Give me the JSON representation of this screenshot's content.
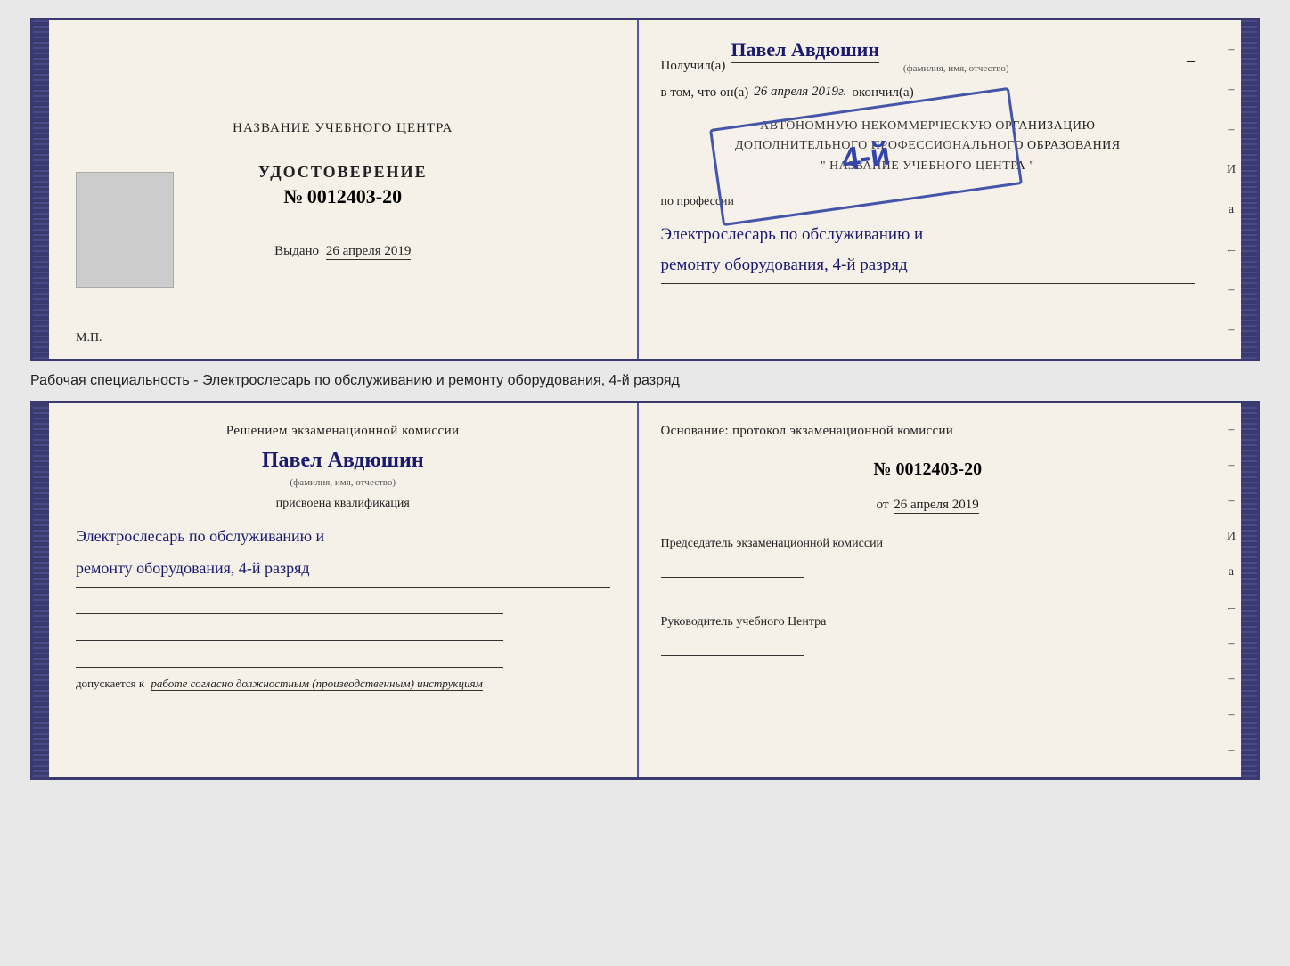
{
  "page": {
    "background_color": "#e8e8e8"
  },
  "top_booklet": {
    "left_page": {
      "title": "НАЗВАНИЕ УЧЕБНОГО ЦЕНТРА",
      "udostoverenie_label": "УДОСТОВЕРЕНИЕ",
      "number_prefix": "№",
      "number": "0012403-20",
      "vydano_label": "Выдано",
      "vydano_date": "26 апреля 2019",
      "mp_label": "М.П."
    },
    "right_page": {
      "poluchil_label": "Получил(a)",
      "recipient_name": "Павел Авдюшин",
      "name_subtitle": "(фамилия, имя, отчество)",
      "vtom_label": "в том, что он(а)",
      "date": "26 апреля 2019г.",
      "okonchil_label": "окончил(а)",
      "stamp_number": "4-й",
      "org_line1": "АВТОНОМНУЮ НЕКОММЕРЧЕСКУЮ ОРГАНИЗАЦИЮ",
      "org_line2": "ДОПОЛНИТЕЛЬНОГО ПРОФЕССИОНАЛЬНОГО ОБРАЗОВАНИЯ",
      "org_line3": "\" НАЗВАНИЕ УЧЕБНОГО ЦЕНТРА \"",
      "po_professii_label": "по профессии",
      "profession_line1": "Электрослесарь по обслуживанию и",
      "profession_line2": "ремонту оборудования, 4-й разряд"
    }
  },
  "between_text": "Рабочая специальность - Электрослесарь по обслуживанию и ремонту оборудования, 4-й разряд",
  "bottom_booklet": {
    "left_page": {
      "reshenie_text": "Решением экзаменационной комиссии",
      "name": "Павел Авдюшин",
      "name_subtitle": "(фамилия, имя, отчество)",
      "prisvoena_label": "присвоена квалификация",
      "profession_line1": "Электрослесарь по обслуживанию и",
      "profession_line2": "ремонту оборудования, 4-й разряд",
      "dopuskaetsya_label": "допускается к",
      "dopuskaetsya_value": "работе согласно должностным (производственным) инструкциям"
    },
    "right_page": {
      "osnovanie_label": "Основание: протокол экзаменационной комиссии",
      "number_prefix": "№",
      "number": "0012403-20",
      "ot_prefix": "от",
      "date": "26 апреля 2019",
      "predsedatel_label": "Председатель экзаменационной комиссии",
      "rukovoditel_label": "Руководитель учебного Центра"
    }
  },
  "dashes": [
    "–",
    "–",
    "–",
    "И",
    "а",
    "←",
    "–",
    "–",
    "–",
    "–"
  ]
}
